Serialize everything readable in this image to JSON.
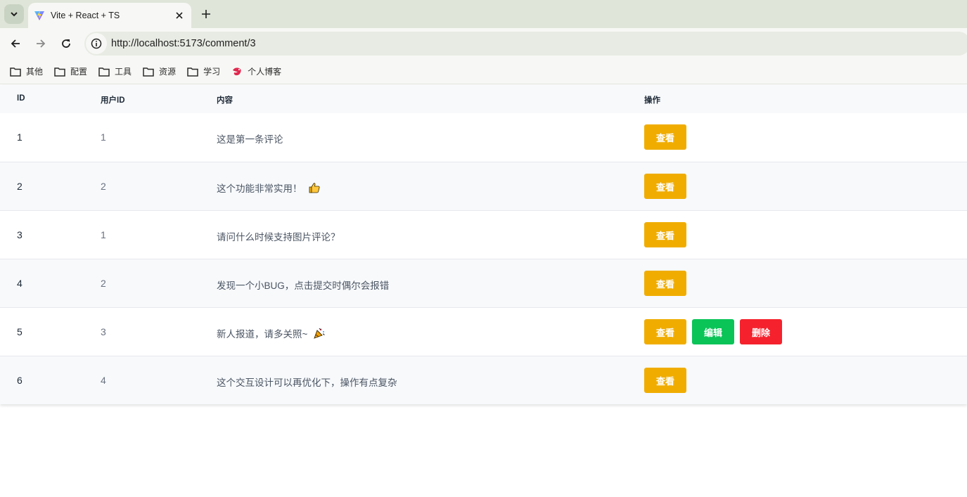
{
  "browser": {
    "tab": {
      "title": "Vite + React + TS"
    },
    "url": "http://localhost:5173/comment/3",
    "bookmarks": [
      {
        "label": "其他",
        "icon": "folder-icon"
      },
      {
        "label": "配置",
        "icon": "folder-icon"
      },
      {
        "label": "工具",
        "icon": "folder-icon"
      },
      {
        "label": "资源",
        "icon": "folder-icon"
      },
      {
        "label": "学习",
        "icon": "folder-icon"
      },
      {
        "label": "个人博客",
        "icon": "blog-favicon-icon"
      }
    ]
  },
  "table": {
    "headers": {
      "id": "ID",
      "user_id": "用户ID",
      "content": "内容",
      "actions": "操作"
    },
    "rows": [
      {
        "id": "1",
        "user_id": "1",
        "content": "这是第一条评论",
        "emoji": ""
      },
      {
        "id": "2",
        "user_id": "2",
        "content": "这个功能非常实用！",
        "emoji": "thumbs-up-icon"
      },
      {
        "id": "3",
        "user_id": "1",
        "content": "请问什么时候支持图片评论？",
        "emoji": ""
      },
      {
        "id": "4",
        "user_id": "2",
        "content": "发现一个小BUG，点击提交时偶尔会报错",
        "emoji": ""
      },
      {
        "id": "5",
        "user_id": "3",
        "content": "新人报道，请多关照~",
        "emoji": "party-popper-icon"
      },
      {
        "id": "6",
        "user_id": "4",
        "content": "这个交互设计可以再优化下，操作有点复杂",
        "emoji": ""
      }
    ],
    "buttons": {
      "view": "查看",
      "edit": "编辑",
      "delete": "删除"
    }
  },
  "colors": {
    "view": "#f0ad00",
    "edit": "#0ac458",
    "delete": "#f5222d"
  }
}
